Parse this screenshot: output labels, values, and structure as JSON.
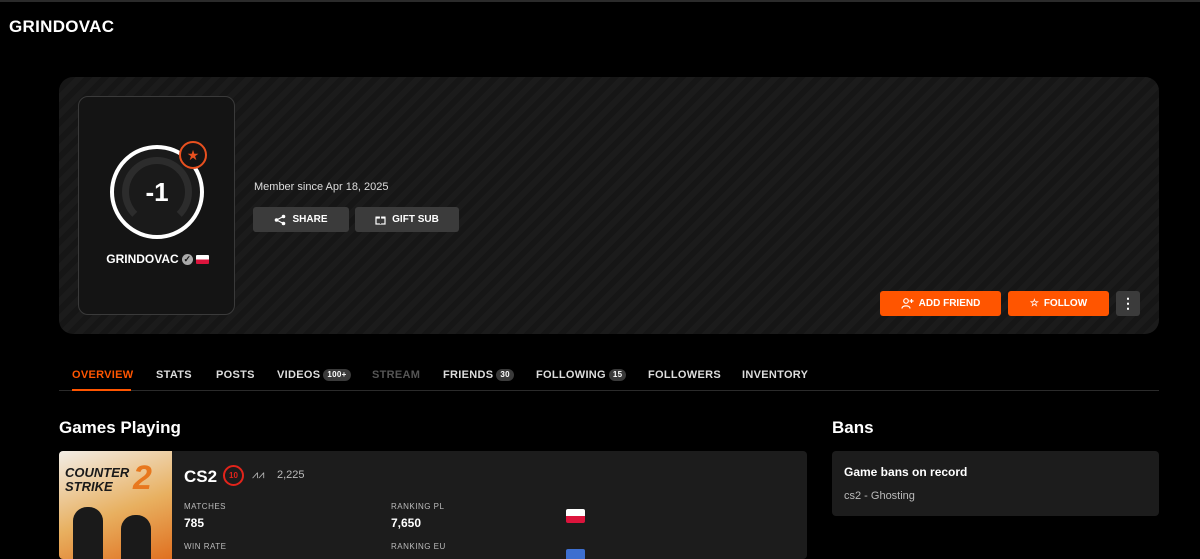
{
  "page": {
    "title": "GRINDOVAC"
  },
  "profile": {
    "level": "-1",
    "username": "GRINDOVAC",
    "member_since": "Member since Apr 18, 2025",
    "buttons": {
      "share": "SHARE",
      "gift_sub": "GIFT SUB",
      "add_friend": "ADD FRIEND",
      "follow": "FOLLOW",
      "more": "⋮"
    }
  },
  "tabs": [
    {
      "label": "OVERVIEW",
      "active": true
    },
    {
      "label": "STATS"
    },
    {
      "label": "POSTS"
    },
    {
      "label": "VIDEOS",
      "count": "100+"
    },
    {
      "label": "STREAM",
      "disabled": true
    },
    {
      "label": "FRIENDS",
      "count": "30"
    },
    {
      "label": "FOLLOWING",
      "count": "15"
    },
    {
      "label": "FOLLOWERS"
    },
    {
      "label": "INVENTORY"
    }
  ],
  "games": {
    "section_title": "Games Playing",
    "art_title_line1": "COUNTER",
    "art_title_line2": "STRIKE",
    "art_number": "2",
    "name": "CS2",
    "skill_level": "10",
    "elo": "2,225",
    "stats": {
      "matches_label": "MATCHES",
      "matches_value": "785",
      "ranking_pl_label": "RANKING PL",
      "ranking_pl_value": "7,650",
      "win_rate_label": "WIN RATE",
      "ranking_eu_label": "RANKING EU"
    }
  },
  "bans": {
    "section_title": "Bans",
    "heading": "Game bans on record",
    "items": [
      "cs2 - Ghosting"
    ]
  },
  "colors": {
    "accent": "#ff5500",
    "background": "#000000",
    "card": "#1c1c1c"
  }
}
